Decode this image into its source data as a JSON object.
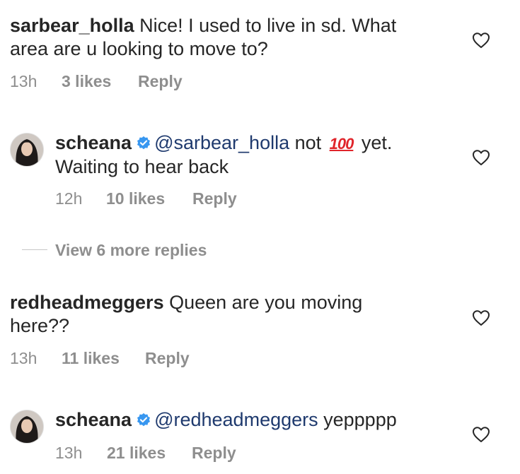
{
  "comments": [
    {
      "username": "sarbear_holla",
      "text_line1": " Nice! I used to live in sd.  What",
      "text_line2": "area are u looking to move to?",
      "time": "13h",
      "likes": "3 likes",
      "reply": "Reply"
    },
    {
      "username": "scheana",
      "mention": "@sarbear_holla",
      "text_a": " not ",
      "emoji": "100",
      "text_b": " yet.",
      "text_line2": "Waiting to hear back",
      "time": "12h",
      "likes": "10 likes",
      "reply": "Reply"
    },
    {
      "username": "redheadmeggers",
      "text_line1": " Queen are you moving",
      "text_line2": "here??",
      "time": "13h",
      "likes": "11 likes",
      "reply": "Reply"
    },
    {
      "username": "scheana",
      "mention": "@redheadmeggers",
      "text_a": " yeppppp",
      "time": "13h",
      "likes": "21 likes",
      "reply": "Reply"
    }
  ],
  "view_more": "View 6 more replies",
  "icons": {
    "like": "heart-outline-icon",
    "verified": "verified-badge-icon",
    "emoji": "hundred-points-emoji"
  },
  "colors": {
    "text": "#262626",
    "meta": "#8e8e8e",
    "mention": "#1f3a6e",
    "verified": "#3897f0",
    "emoji": "#e0252b"
  }
}
